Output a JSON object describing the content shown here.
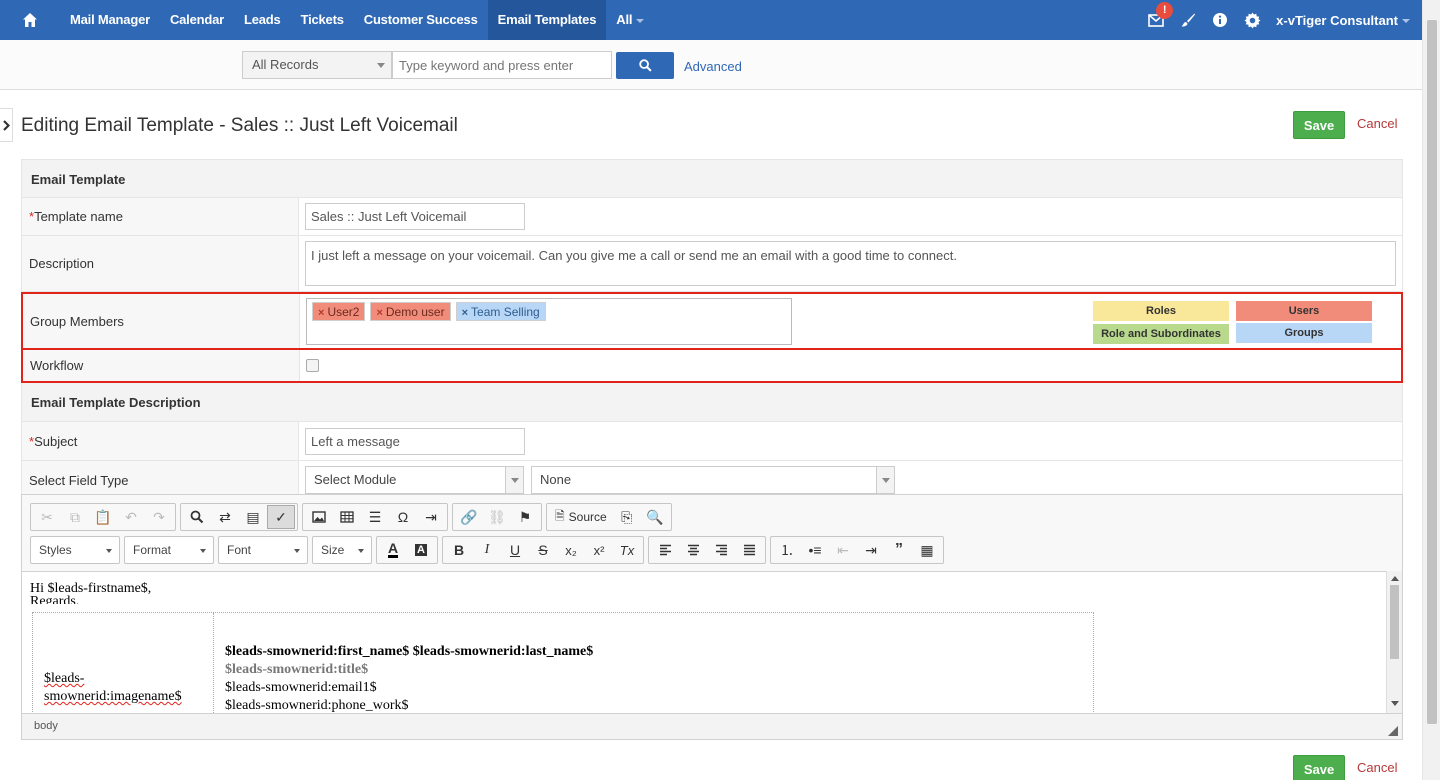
{
  "nav": {
    "items": [
      "Mail Manager",
      "Calendar",
      "Leads",
      "Tickets",
      "Customer Success",
      "Email Templates",
      "All"
    ],
    "active_index": 5,
    "badge": "!",
    "user": "x-vTiger Consultant"
  },
  "search": {
    "filter": "All Records",
    "placeholder": "Type keyword and press enter",
    "advanced": "Advanced"
  },
  "page": {
    "title": "Editing Email Template - Sales :: Just Left Voicemail",
    "save": "Save",
    "cancel": "Cancel"
  },
  "form": {
    "section1": "Email Template",
    "template_name_label": "Template name",
    "template_name_value": "Sales :: Just Left Voicemail",
    "description_label": "Description",
    "description_value": "I just left a message on your voicemail. Can you give me a call or send me an email with a good time to connect.",
    "group_members_label": "Group Members",
    "members": [
      "User2",
      "Demo user",
      "Team Selling"
    ],
    "legend": {
      "roles": "Roles",
      "users": "Users",
      "role_subs": "Role and Subordinates",
      "groups": "Groups"
    },
    "workflow_label": "Workflow",
    "section2": "Email Template Description",
    "subject_label": "Subject",
    "subject_value": "Left a message",
    "field_type_label": "Select Field Type",
    "module_select": "Select Module",
    "none_select": "None"
  },
  "editor": {
    "source": "Source",
    "styles": "Styles",
    "format": "Format",
    "font": "Font",
    "size": "Size",
    "line1": "Hi $leads-firstname$,",
    "line2": "Regards,",
    "image_field": "$leads-smownerid:imagename$",
    "image_field_a": "$leads-",
    "image_field_b": "smownerid:imagename$",
    "sig_name": "$leads-smownerid:first_name$ $leads-smownerid:last_name$",
    "sig_title": "$leads-smownerid:title$",
    "sig_email": "$leads-smownerid:email1$",
    "sig_phone": "$leads-smownerid:phone_work$",
    "status": "body"
  },
  "colors": {
    "nav_bg": "#2f68b5",
    "save_green": "#4cae4c",
    "highlight_red": "#e2231a",
    "roles_yellow": "#f9e79a",
    "users_red": "#f28c7a",
    "role_subs_green": "#b9d98d",
    "groups_blue": "#b8d6f6"
  }
}
